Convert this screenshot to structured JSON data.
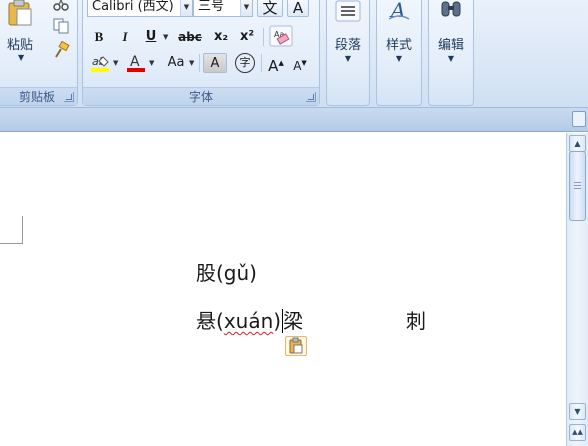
{
  "ribbon": {
    "clipboard": {
      "paste_label": "粘贴",
      "group_title": "剪贴板",
      "icons": [
        "paste-icon",
        "cut-icon",
        "copy-icon",
        "format-painter-icon"
      ]
    },
    "font": {
      "font_name": "Calibri (西文)",
      "font_size": "三号",
      "group_title": "字体",
      "pinyin_button": "文",
      "bold": "B",
      "italic": "I",
      "underline": "U",
      "strikethrough": "abc",
      "subscript": "x₂",
      "superscript": "x²",
      "change_case": "Aa",
      "char_shading": "A",
      "enclose_char": "字",
      "grow_font": "A",
      "shrink_font": "A",
      "highlight_color": "#ffff00",
      "font_color": "#e00000"
    },
    "paragraph": {
      "label": "段落"
    },
    "styles": {
      "label": "样式"
    },
    "editing": {
      "label": "编辑"
    }
  },
  "document": {
    "line1": "股(gǔ)",
    "line2_prefix": "悬(",
    "line2_pinyin": "xuán",
    "line2_close": ")",
    "line2_after_caret": "梁",
    "line2_far": "刺"
  },
  "colors": {
    "ribbon_bg": "#dbe7f6",
    "group_title": "#3b5a86",
    "accent_border": "#a9c3e2"
  }
}
